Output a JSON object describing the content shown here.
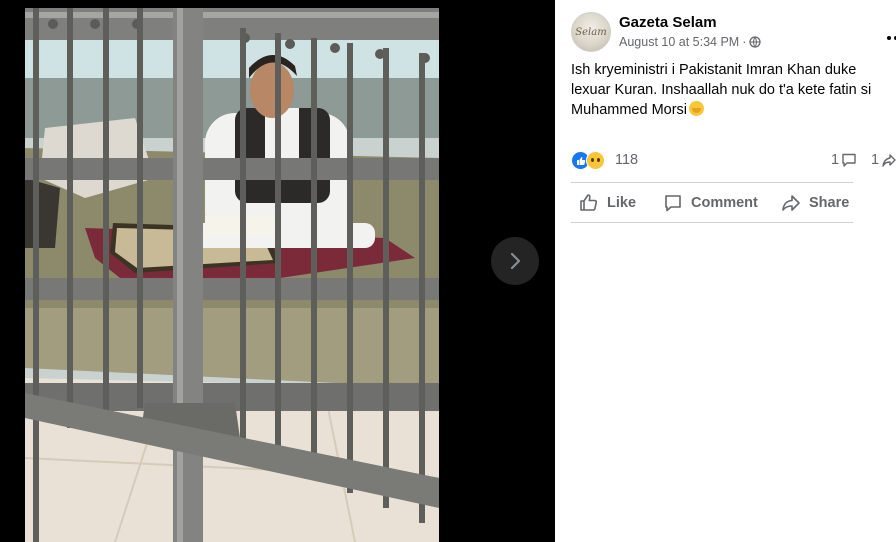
{
  "post": {
    "author": "Gazeta Selam",
    "avatar_text": "Selam",
    "timestamp": "August 10 at 5:34 PM",
    "separator": "·",
    "privacy_icon": "globe-icon",
    "text": "Ish kryeministri i Pakistanit Imran Khan duke lexuar Kuran. Inshaallah nuk do t'a kete fatin si Muhammed Morsi",
    "emoji": "praying-hands-emoji"
  },
  "reactions": {
    "types": [
      "like",
      "sad"
    ],
    "count": "118",
    "comments": "1",
    "shares": "1"
  },
  "actions": {
    "like": "Like",
    "comment": "Comment",
    "share": "Share"
  },
  "viewer": {
    "next_icon": "chevron-right-icon",
    "photo_description_icon": "photo"
  },
  "colors": {
    "accent": "#1877f2",
    "text_secondary": "#65676b",
    "viewer_bg": "#000000"
  }
}
